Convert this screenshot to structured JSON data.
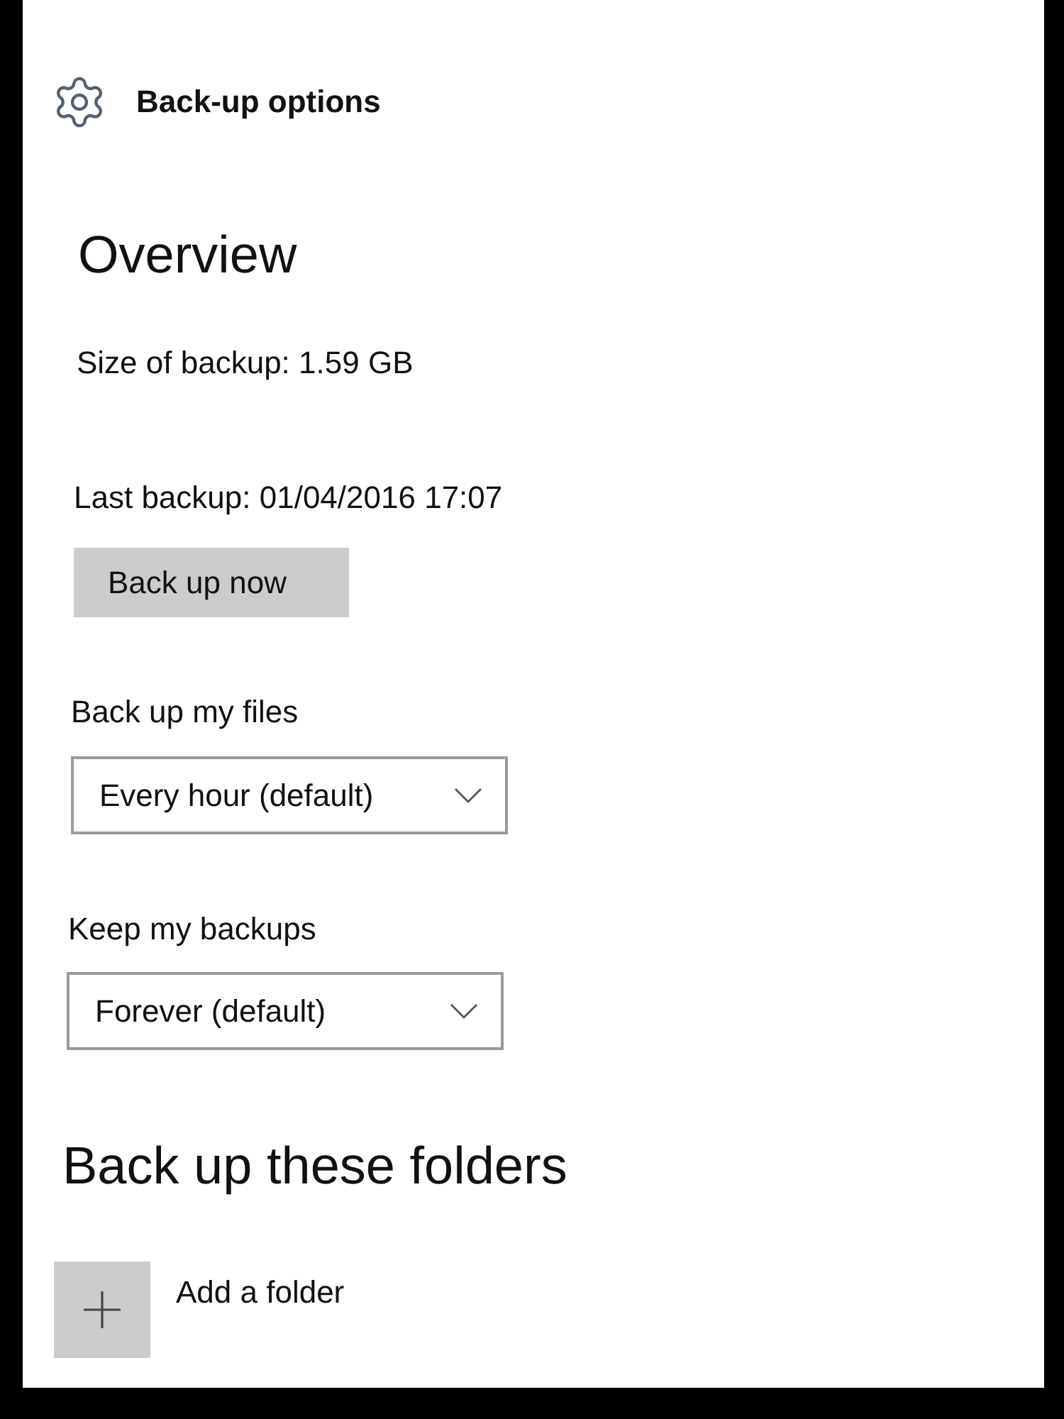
{
  "header": {
    "title": "Back-up options"
  },
  "overview": {
    "heading": "Overview",
    "size": "Size of backup: 1.59 GB",
    "last_backup": "Last backup: 01/04/2016 17:07",
    "button": "Back up now"
  },
  "settings": [
    {
      "label": "Back up my files",
      "value": "Every hour (default)"
    },
    {
      "label": "Keep my backups",
      "value": "Forever (default)"
    }
  ],
  "folders": {
    "heading": "Back up these folders",
    "add_label": "Add a folder"
  }
}
